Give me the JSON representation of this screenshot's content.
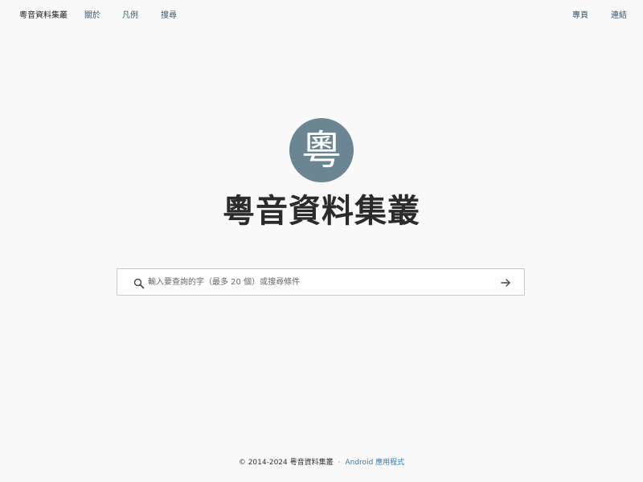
{
  "nav": {
    "brand": "粵音資料集叢",
    "left_items": [
      "關於",
      "凡例",
      "搜尋"
    ],
    "right_items": [
      "專頁",
      "連結"
    ]
  },
  "hero": {
    "logo_char": "粵",
    "title": "粵音資料集叢"
  },
  "search": {
    "placeholder": "輸入要查詢的字（最多 20 個）或搜尋條件",
    "value": "",
    "icon": "search-icon",
    "submit_icon": "arrow-right-icon"
  },
  "footer": {
    "copyright": "© 2014-2024 粵音資料集叢",
    "separator": "·",
    "android_link": "Android 應用程式"
  },
  "colors": {
    "background": "#f9f9f9",
    "logo_circle": "#6b8592",
    "link_accent": "#2a7fbf"
  }
}
